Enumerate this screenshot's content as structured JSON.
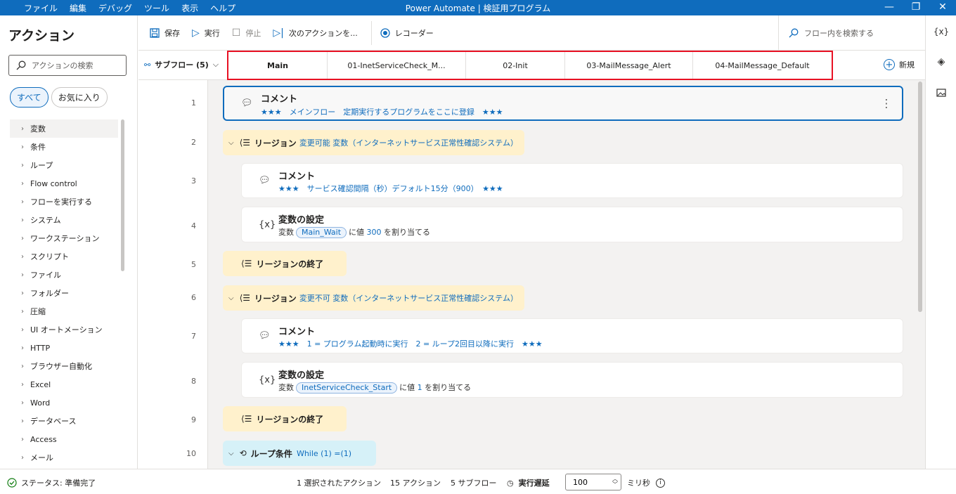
{
  "titlebar": {
    "menu": [
      "ファイル",
      "編集",
      "デバッグ",
      "ツール",
      "表示",
      "ヘルプ"
    ],
    "title": "Power Automate | 検証用プログラム"
  },
  "left_panel": {
    "title": "アクション",
    "search_placeholder": "アクションの検索",
    "tabs": [
      "すべて",
      "お気に入り"
    ],
    "categories": [
      "変数",
      "条件",
      "ループ",
      "Flow control",
      "フローを実行する",
      "システム",
      "ワークステーション",
      "スクリプト",
      "ファイル",
      "フォルダー",
      "圧縮",
      "UI オートメーション",
      "HTTP",
      "ブラウザー自動化",
      "Excel",
      "Word",
      "データベース",
      "Access",
      "メール"
    ]
  },
  "toolbar": {
    "save": "保存",
    "run": "実行",
    "stop": "停止",
    "next_action": "次のアクションを...",
    "recorder": "レコーダー",
    "search_placeholder": "フロー内を検索する"
  },
  "subflows": {
    "dropdown_label": "サブフロー (5)",
    "tabs": [
      "Main",
      "01-InetServiceCheck_M...",
      "02-Init",
      "03-MailMessage_Alert",
      "04-MailMessage_Default"
    ],
    "new_label": "新規"
  },
  "right_rail": {
    "variables_label": "{x}"
  },
  "flow": {
    "line_numbers": [
      "1",
      "2",
      "3",
      "4",
      "5",
      "6",
      "7",
      "8",
      "9",
      "10"
    ],
    "a1": {
      "title": "コメント",
      "desc": "★★★　メインフロー　定期実行するプログラムをここに登録　★★★"
    },
    "r2": {
      "title": "リージョン",
      "desc": "変更可能 変数（インターネットサービス正常性確認システム）"
    },
    "a3": {
      "title": "コメント",
      "desc": "★★★　サービス確認間隔（秒）デフォルト15分（900）　★★★"
    },
    "a4": {
      "title": "変数の設定",
      "prefix": "変数",
      "var": "Main_Wait",
      "mid": "に値",
      "value": "300",
      "suffix": "を割り当てる"
    },
    "r5": {
      "title": "リージョンの終了"
    },
    "r6": {
      "title": "リージョン",
      "desc": "変更不可 変数（インターネットサービス正常性確認システム）"
    },
    "a7": {
      "title": "コメント",
      "desc": "★★★　1 = プログラム起動時に実行　2 = ループ2回目以降に実行　★★★"
    },
    "a8": {
      "title": "変数の設定",
      "prefix": "変数",
      "var": "InetServiceCheck_Start",
      "mid": "に値",
      "value": "1",
      "suffix": "を割り当てる"
    },
    "r9": {
      "title": "リージョンの終了"
    },
    "l10": {
      "title": "ループ条件",
      "desc": "While (1) =(1)"
    }
  },
  "statusbar": {
    "status": "ステータス: 準備完了",
    "selected": "1 選択されたアクション",
    "actions": "15 アクション",
    "subflows": "5 サブフロー",
    "delay_label": "実行遅延",
    "delay_value": "100",
    "unit": "ミリ秒"
  }
}
